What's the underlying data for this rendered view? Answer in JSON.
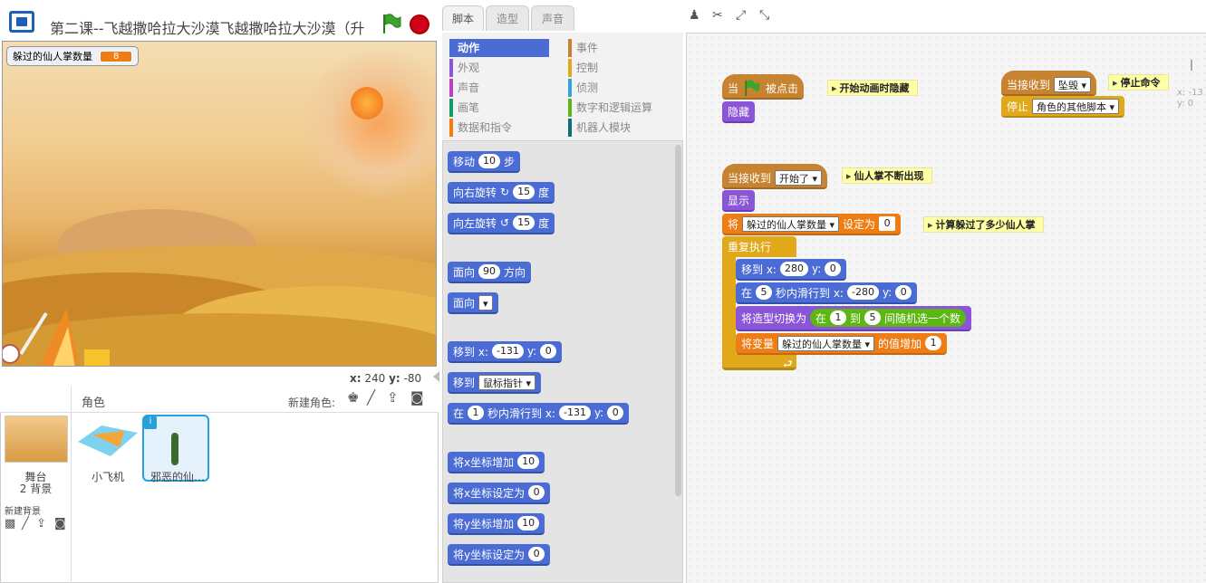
{
  "header": {
    "title": "第二课--飞越撒哈拉大沙漠飞越撒哈拉大沙漠（升"
  },
  "stage": {
    "monitor": {
      "label": "躲过的仙人掌数量",
      "value": "8"
    },
    "coords": {
      "x_label": "x:",
      "x": "240",
      "y_label": "y:",
      "y": "-80"
    }
  },
  "sprites": {
    "header_label": "角色",
    "new_sprite_label": "新建角色:",
    "stage_name": "舞台",
    "stage_backdrops": "2 背景",
    "new_backdrop_label": "新建背景",
    "items": [
      {
        "name": "小飞机"
      },
      {
        "name": "邪恶的仙…"
      }
    ]
  },
  "tabs": [
    "脚本",
    "造型",
    "声音"
  ],
  "categories": [
    {
      "label": "动作",
      "color": "#4a6cd4"
    },
    {
      "label": "事件",
      "color": "#c88330"
    },
    {
      "label": "外观",
      "color": "#8a55d7"
    },
    {
      "label": "控制",
      "color": "#e1a91a"
    },
    {
      "label": "声音",
      "color": "#bb42c3"
    },
    {
      "label": "侦测",
      "color": "#2ca5e2"
    },
    {
      "label": "画笔",
      "color": "#0e9a6c"
    },
    {
      "label": "数字和逻辑运算",
      "color": "#5cb712"
    },
    {
      "label": "数据和指令",
      "color": "#ee7d16"
    },
    {
      "label": "机器人模块",
      "color": "#0e6e7a"
    }
  ],
  "palette": {
    "move": {
      "a": "移动",
      "n": "10",
      "b": "步"
    },
    "turn_right": {
      "a": "向右旋转",
      "icon": "↻",
      "n": "15",
      "b": "度"
    },
    "turn_left": {
      "a": "向左旋转",
      "icon": "↺",
      "n": "15",
      "b": "度"
    },
    "point_dir": {
      "a": "面向",
      "n": "90",
      "b": "方向"
    },
    "point_towards": {
      "a": "面向",
      "dd": ""
    },
    "goto_xy": {
      "a": "移到 x:",
      "x": "-131",
      "y_label": "y:",
      "y": "0"
    },
    "goto": {
      "a": "移到",
      "dd": "鼠标指针"
    },
    "glide": {
      "a": "在",
      "n": "1",
      "b": "秒内滑行到 x:",
      "x": "-131",
      "y_label": "y:",
      "y": "0"
    },
    "change_x": {
      "a": "将x坐标增加",
      "n": "10"
    },
    "set_x": {
      "a": "将x坐标设定为",
      "n": "0"
    },
    "change_y": {
      "a": "将y坐标增加",
      "n": "10"
    },
    "set_y": {
      "a": "将y坐标设定为",
      "n": "0"
    }
  },
  "scripts": {
    "s1": {
      "hat_a": "当",
      "hat_b": "被点击",
      "comment": "开始动画时隐藏",
      "hide": "隐藏"
    },
    "s2": {
      "hat": "当接收到",
      "hat_dd": "坠毁",
      "comment": "停止命令",
      "stop": "停止",
      "stop_dd": "角色的其他脚本"
    },
    "s3": {
      "hat": "当接收到",
      "hat_dd": "开始了",
      "comment": "仙人掌不断出现",
      "show": "显示",
      "set_a": "将",
      "set_dd": "躲过的仙人掌数量",
      "set_b": "设定为",
      "set_val": "0",
      "set_comment": "计算躲过了多少仙人掌",
      "forever": "重复执行",
      "goto_a": "移到 x:",
      "goto_x": "280",
      "goto_y_label": "y:",
      "goto_y": "0",
      "glide_a": "在",
      "glide_n": "5",
      "glide_b": "秒内滑行到 x:",
      "glide_x": "-280",
      "glide_y_label": "y:",
      "glide_y": "0",
      "costume_a": "将造型切换为",
      "rand_a": "在",
      "rand_min": "1",
      "rand_b": "到",
      "rand_max": "5",
      "rand_c": "间随机选一个数",
      "change_a": "将变量",
      "change_dd": "躲过的仙人掌数量",
      "change_b": "的值增加",
      "change_val": "1"
    },
    "xy_hint": {
      "x": "x: -13",
      "y": "y: 0"
    }
  }
}
